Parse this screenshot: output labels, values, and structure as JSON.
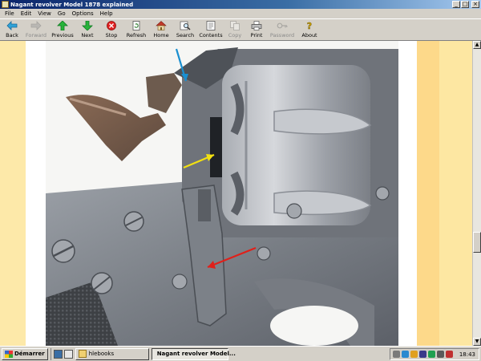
{
  "window": {
    "title": "Nagant revolver Model 1878 explained"
  },
  "window_buttons": {
    "minimize": "_",
    "maximize": "□",
    "close": "×"
  },
  "menu": [
    "File",
    "Edit",
    "View",
    "Go",
    "Options",
    "Help"
  ],
  "toolbar": [
    {
      "label": "Back",
      "icon": "back-arrow-icon",
      "enabled": true
    },
    {
      "label": "Forward",
      "icon": "forward-arrow-icon",
      "enabled": false
    },
    {
      "label": "Previous",
      "icon": "up-arrow-icon",
      "enabled": true
    },
    {
      "label": "Next",
      "icon": "down-arrow-icon",
      "enabled": true
    },
    {
      "label": "Stop",
      "icon": "stop-icon",
      "enabled": true
    },
    {
      "label": "Refresh",
      "icon": "refresh-icon",
      "enabled": true
    },
    {
      "label": "Home",
      "icon": "home-icon",
      "enabled": true
    },
    {
      "label": "Search",
      "icon": "search-icon",
      "enabled": true
    },
    {
      "label": "Contents",
      "icon": "contents-icon",
      "enabled": true
    },
    {
      "label": "Copy",
      "icon": "copy-icon",
      "enabled": false
    },
    {
      "label": "Print",
      "icon": "print-icon",
      "enabled": true
    },
    {
      "label": "Password",
      "icon": "password-key-icon",
      "enabled": false
    },
    {
      "label": "About",
      "icon": "about-icon",
      "enabled": true
    }
  ],
  "taskbar": {
    "start_label": "Démarrer",
    "tasks": [
      {
        "label": "hlebooks",
        "icon": "folder-icon",
        "active": false
      },
      {
        "label": "Nagant revolver Model...",
        "icon": "ebook-app-icon",
        "active": true
      }
    ],
    "clock": "18:43"
  },
  "colors": {
    "title_bar": "#0a246a",
    "page_background": "#fbf3d2",
    "stripe_left": "#fde9a9",
    "stripe_right": "#fdd98a",
    "arrow_blue": "#1a8fd0",
    "arrow_yellow": "#f2e012",
    "arrow_red": "#e0201a"
  }
}
